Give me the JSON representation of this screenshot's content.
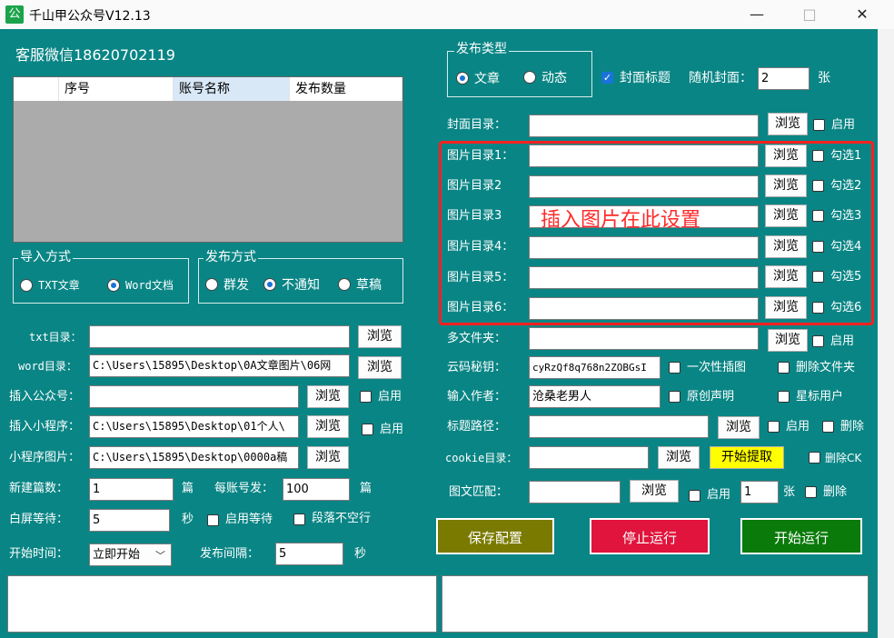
{
  "window": {
    "app_icon_glyph": "公",
    "title": "千山甲公众号V12.13",
    "minimize": "—",
    "maximize": "□",
    "close": "✕"
  },
  "left": {
    "service_label": "客服微信18620702119",
    "grid_headers": [
      "",
      "序号",
      "账号名称",
      "发布数量"
    ],
    "import_group": {
      "title": "导入方式",
      "options": [
        "TXT文章",
        "Word文档"
      ],
      "selected": 1
    },
    "publish_group": {
      "title": "发布方式",
      "options": [
        "群发",
        "不通知",
        "草稿"
      ],
      "selected": 1
    },
    "txt_dir": {
      "label": "txt目录：",
      "value": "",
      "browse": "浏览"
    },
    "word_dir": {
      "label": "word目录：",
      "value": "C:\\Users\\15895\\Desktop\\0A文章图片\\06网",
      "browse": "浏览"
    },
    "insert_account": {
      "label": "插入公众号：",
      "value": "",
      "browse": "浏览",
      "enable": "启用"
    },
    "insert_miniprogram": {
      "label": "插入小程序：",
      "value": "C:\\Users\\15895\\Desktop\\01个人\\",
      "browse": "浏览",
      "enable": "启用"
    },
    "miniprogram_image": {
      "label": "小程序图片：",
      "value": "C:\\Users\\15895\\Desktop\\0000a稿",
      "browse": "浏览"
    },
    "new_count": {
      "label": "新建篇数：",
      "value": "1",
      "unit": "篇"
    },
    "per_account": {
      "label": "每账号发：",
      "value": "100",
      "unit": "篇"
    },
    "white_wait": {
      "label": "白屏等待：",
      "value": "5",
      "unit": "秒"
    },
    "enable_wait": "启用等待",
    "no_blank_para": "段落不空行",
    "start_time": {
      "label": "开始时间：",
      "value": "立即开始",
      "arrow": "﹀"
    },
    "interval": {
      "label": "发布间隔：",
      "value": "5",
      "unit": "秒"
    }
  },
  "right": {
    "publish_type": {
      "title": "发布类型",
      "options": [
        "文章",
        "动态"
      ],
      "selected": 0
    },
    "cover_title": {
      "label": "封面标题",
      "checked": true
    },
    "random_cover": {
      "label": "随机封面：",
      "value": "2",
      "unit": "张"
    },
    "cover_dir": {
      "label": "封面目录：",
      "value": "",
      "browse": "浏览",
      "enable": "启用"
    },
    "image_dirs": [
      {
        "label": "图片目录1：",
        "value": "",
        "browse": "浏览",
        "check": "勾选1"
      },
      {
        "label": "图片目录2",
        "value": "",
        "browse": "浏览",
        "check": "勾选2"
      },
      {
        "label": "图片目录3",
        "value": "",
        "browse": "浏览",
        "check": "勾选3"
      },
      {
        "label": "图片目录4：",
        "value": "",
        "browse": "浏览",
        "check": "勾选4"
      },
      {
        "label": "图片目录5：",
        "value": "",
        "browse": "浏览",
        "check": "勾选5"
      },
      {
        "label": "图片目录6：",
        "value": "",
        "browse": "浏览",
        "check": "勾选6"
      }
    ],
    "image_hint": "插入图片在此设置",
    "multi_folder": {
      "label": "多文件夹：",
      "value": "",
      "browse": "浏览",
      "enable": "启用"
    },
    "cloud_key": {
      "label": "云码秘钥：",
      "value": "cyRzQf8q768n2ZOBGsI",
      "one_time": "一次性插图",
      "delete_folder": "删除文件夹"
    },
    "author": {
      "label": "输入作者：",
      "value": "沧桑老男人",
      "original": "原创声明",
      "star_user": "星标用户"
    },
    "title_path": {
      "label": "标题路径：",
      "value": "",
      "browse": "浏览",
      "enable": "启用",
      "delete": "删除"
    },
    "cookie_dir": {
      "label": "cookie目录：",
      "value": "",
      "browse": "浏览",
      "extract": "开始提取",
      "delete_ck": "删除CK"
    },
    "image_match": {
      "label": "图文匹配：",
      "value": "",
      "browse": "浏览",
      "enable": "启用",
      "count": "1",
      "unit": "张",
      "delete": "删除"
    },
    "save_btn": "保存配置",
    "stop_btn": "停止运行",
    "start_btn": "开始运行",
    "colors": {
      "save": "#7a7a00",
      "stop": "#e0143c",
      "start": "#0a7a0a",
      "hint": "#ff2a2a",
      "bg": "#0a8585"
    }
  }
}
